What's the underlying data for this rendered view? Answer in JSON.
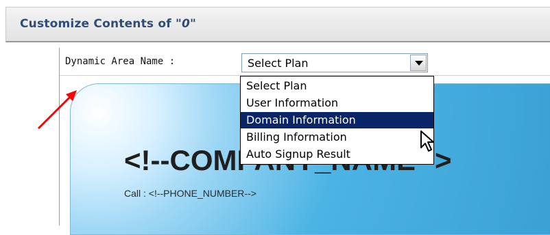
{
  "header": {
    "title_prefix": "Customize Contents of ",
    "title_quoted": "\"0\""
  },
  "form": {
    "area_label": "Dynamic Area Name :",
    "select_value": "Select Plan"
  },
  "dropdown": {
    "options": [
      "Select Plan",
      "User Information",
      "Domain Information",
      "Billing Information",
      "Auto Signup Result"
    ],
    "highlighted_index": 2
  },
  "banner": {
    "title": "<!--COMPANY_NAME-->",
    "phone": "Call : <!--PHONE_NUMBER-->"
  },
  "colors": {
    "header_text": "#2f4d75",
    "selection_bg": "#0a246a",
    "annotation_arrow": "#ff0000",
    "banner_blue": "#3aa0d4"
  },
  "icons": {
    "select_button": "chevron-down-icon",
    "annotation": "arrow-annotation-icon",
    "cursor": "mouse-cursor-icon"
  }
}
